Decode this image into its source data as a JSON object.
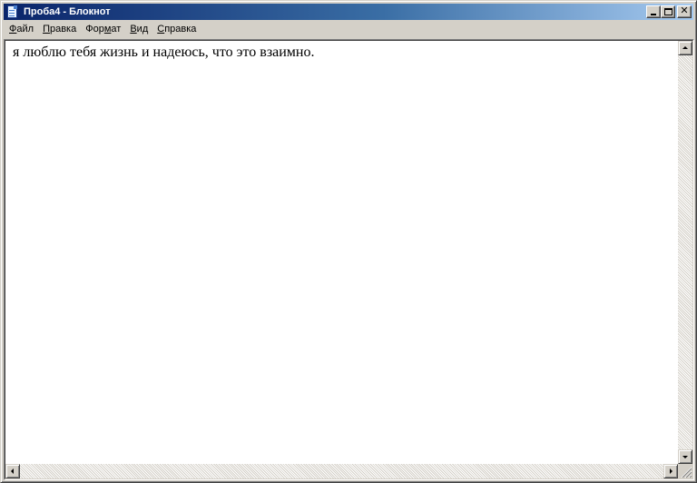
{
  "window": {
    "title": "Проба4 - Блокнот",
    "title_bar_color": "#0a246a"
  },
  "menu": {
    "items": [
      {
        "accel": "Ф",
        "rest": "айл"
      },
      {
        "accel": "П",
        "rest": "равка"
      },
      {
        "pre": "Фор",
        "accel": "м",
        "rest": "ат"
      },
      {
        "accel": "В",
        "rest": "ид"
      },
      {
        "accel": "С",
        "rest": "правка"
      }
    ]
  },
  "editor": {
    "content": "я люблю тебя жизнь и надеюсь, что это взаимно."
  },
  "icons": {
    "app": "notepad-icon",
    "minimize": "minimize-icon",
    "maximize": "maximize-icon",
    "close": "close-icon",
    "scroll_up": "arrow-up-icon",
    "scroll_down": "arrow-down-icon",
    "scroll_left": "arrow-left-icon",
    "scroll_right": "arrow-right-icon",
    "size_grip": "size-grip-icon"
  }
}
